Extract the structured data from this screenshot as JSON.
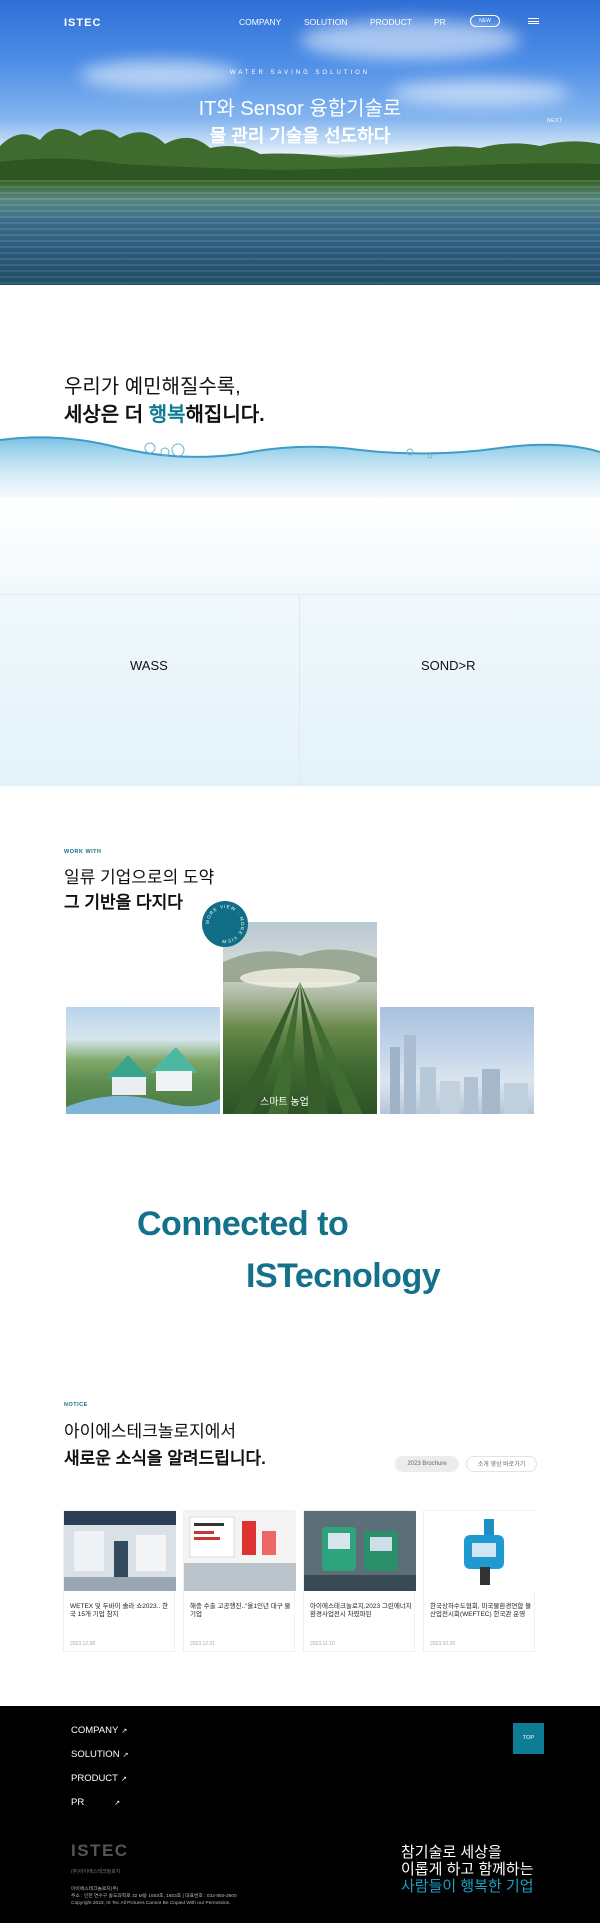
{
  "header": {
    "logo": "ISTEC",
    "nav": [
      "COMPANY",
      "SOLUTION",
      "PRODUCT",
      "PR"
    ],
    "new_badge": "NEW",
    "menu_icon": "hamburger-icon"
  },
  "hero": {
    "tagline": "WATER SAVING SOLUTION",
    "line1": "IT와 Sensor 융합기술로",
    "line2": "물 관리 기술을 선도하다",
    "next_label": "NEXT"
  },
  "intro": {
    "line1": "우리가 예민해질수록,",
    "line2_pre": "세상은 더 ",
    "line2_highlight": "행복",
    "line2_post": "해집니다."
  },
  "solutions": {
    "left": "WASS",
    "right": "SOND>R"
  },
  "work": {
    "eyebrow": "WORK WITH",
    "line1": "일류 기업으로의 도약",
    "line2": "그 기반을 다지다",
    "badge_text": "MORE VIEW · MORE VIEW ·",
    "center_caption": "스마트 농업"
  },
  "connected": {
    "line1": "Connected to",
    "line2": "ISTecnology"
  },
  "notice": {
    "eyebrow": "NOTICE",
    "line1": "아이에스테크놀로지에서",
    "line2": "새로운 소식을 알려드립니다.",
    "brochure_button": "2023 Brochure",
    "video_button": "소개 영상 바로가기",
    "items": [
      {
        "title": "WETEX 및 두바이 솔라 쇼2023.. 한국 15개 기업 참지",
        "date": "2023.12.08"
      },
      {
        "title": "해충 수출 고공행진..\"올1인년 대구 물기업",
        "date": "2023.12.01"
      },
      {
        "title": "아이에스테크놀로지,2023 그린에너지환경사업전시 차렸파된",
        "date": "2023.11.10"
      },
      {
        "title": "한국상하수도협회, 미국물환경연합 물산업전시회(WEFTEC) 한국관 운영",
        "date": "2023.10.20"
      }
    ]
  },
  "footer": {
    "nav": [
      "COMPANY",
      "SOLUTION",
      "PRODUCT",
      "PR"
    ],
    "arrow": "↗",
    "top_button": "TOP",
    "logo": "ISTEC",
    "sub": "(주)아이에스테크놀로지",
    "info1": "아이에스테크놀로지(주)",
    "info2": "주소 : 인천 연수구 송도과학로 32 M동 1603호, 1603호   |   대표번호 : 032-850-2600",
    "info3": "Copyright 2023, IS Tec All Pictures Cannot Be Copied With our Permission.",
    "slogan1": "참기술로 세상을",
    "slogan2": "이롭게 하고 함께하는",
    "slogan3": "사람들이 행복한 기업"
  },
  "colors": {
    "accent": "#13718a",
    "accent_light": "#17a1c0",
    "footer_bg": "#000000"
  }
}
